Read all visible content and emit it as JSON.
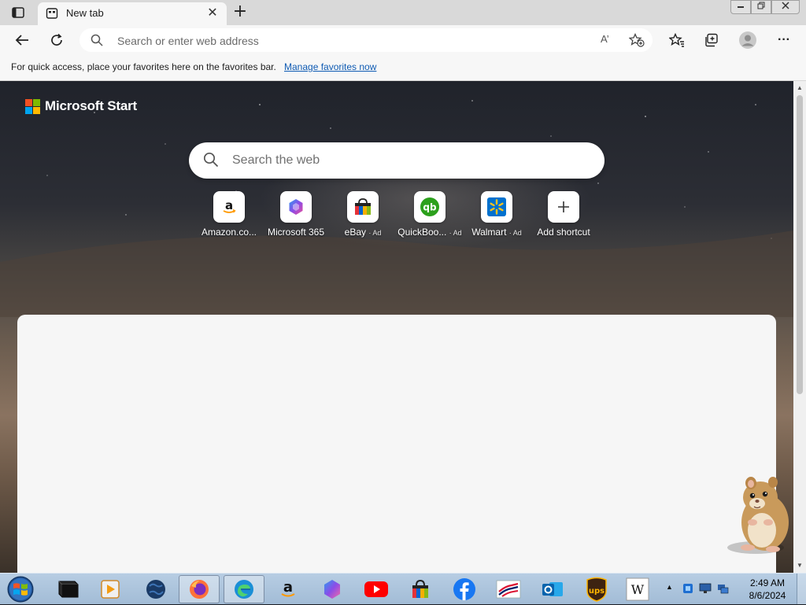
{
  "window": {
    "minimize_glyph": "▭",
    "restore_glyph": "❐",
    "close_glyph": "✕"
  },
  "tabs": [
    {
      "title": "New tab",
      "close_glyph": "✕"
    }
  ],
  "new_tab_glyph": "+",
  "toolbar": {
    "address_placeholder": "Search or enter web address",
    "read_aloud_glyph": "A’",
    "more_glyph": "···"
  },
  "favorites_bar": {
    "message": "For quick access, place your favorites here on the favorites bar.",
    "link": "Manage favorites now"
  },
  "newtab_page": {
    "brand": "Microsoft Start",
    "search_placeholder": "Search the web",
    "shortcuts": [
      {
        "label": "Amazon.co...",
        "ad": "",
        "icon": "amazon-icon"
      },
      {
        "label": "Microsoft 365",
        "ad": "",
        "icon": "microsoft-365-icon"
      },
      {
        "label": "eBay",
        "ad": "· Ad",
        "icon": "ebay-icon"
      },
      {
        "label": "QuickBoo...",
        "ad": "· Ad",
        "icon": "quickbooks-icon"
      },
      {
        "label": "Walmart",
        "ad": "· Ad",
        "icon": "walmart-icon"
      },
      {
        "label": "Add shortcut",
        "ad": "",
        "icon": "plus-icon"
      }
    ]
  },
  "taskbar": {
    "apps": [
      "terminal-icon",
      "media-player-icon",
      "globe-icon",
      "firefox-icon",
      "edge-icon",
      "amazon-icon",
      "copilot-icon",
      "youtube-icon",
      "ebay-icon",
      "facebook-icon",
      "bank-of-america-icon",
      "outlook-icon",
      "ups-icon",
      "wikipedia-icon"
    ],
    "clock_time": "2:49 AM",
    "clock_date": "8/6/2024",
    "tray_arrow": "▲"
  },
  "colors": {
    "accent": "#0f5bb3",
    "amazon_orange": "#ff9900",
    "quickbooks_green": "#2ca01c",
    "walmart_blue": "#0071ce",
    "youtube_red": "#ff0000",
    "facebook_blue": "#1877f2"
  }
}
